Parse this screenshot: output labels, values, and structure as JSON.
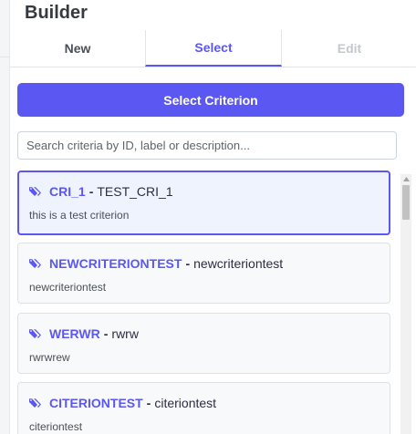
{
  "header": {
    "title": "Builder"
  },
  "tabs": [
    {
      "label": "New",
      "state": "normal"
    },
    {
      "label": "Select",
      "state": "active"
    },
    {
      "label": "Edit",
      "state": "disabled"
    }
  ],
  "select_button": {
    "label": "Select Criterion"
  },
  "search": {
    "placeholder": "Search criteria by ID, label or description...",
    "value": ""
  },
  "criteria": [
    {
      "id": "CRI_1",
      "separator": "-",
      "label": "TEST_CRI_1",
      "description": "this is a test criterion",
      "selected": true,
      "icon": "tag-icon"
    },
    {
      "id": "NEWCRITERIONTEST",
      "separator": "-",
      "label": "newcriteriontest",
      "description": "newcriteriontest",
      "selected": false,
      "icon": "tag-icon"
    },
    {
      "id": "WERWR",
      "separator": "-",
      "label": "rwrw",
      "description": "rwrwrew",
      "selected": false,
      "icon": "tag-icon"
    },
    {
      "id": "CITERIONTEST",
      "separator": "-",
      "label": "citeriontest",
      "description": "citeriontest",
      "selected": false,
      "icon": "tag-icon"
    }
  ],
  "colors": {
    "accent": "#5b57f2",
    "selected_bg": "#eef3fd",
    "card_bg": "#f8f9fa"
  }
}
